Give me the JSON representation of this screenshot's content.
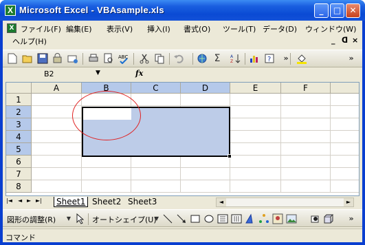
{
  "window": {
    "title": "Microsoft Excel - VBAsample.xls",
    "app_icon": "X",
    "minimize": "_",
    "maximize": "□",
    "close": "✕"
  },
  "menu": {
    "items": [
      "ファイル(F)",
      "編集(E)",
      "表示(V)",
      "挿入(I)",
      "書式(O)",
      "ツール(T)",
      "データ(D)",
      "ウィンドウ(W)"
    ],
    "help": "ヘルプ(H)",
    "mdi_minimize": "_",
    "mdi_restore": "ᗡ",
    "mdi_close": "×"
  },
  "toolbar": {
    "icons": [
      "new-icon",
      "open-icon",
      "save-icon",
      "permission-icon",
      "email-icon",
      "print-icon",
      "print-preview-icon",
      "spelling-icon",
      "cut-icon",
      "copy-icon",
      "undo-icon",
      "hyperlink-icon",
      "autosum-icon",
      "sort-ascending-icon",
      "chart-wizard-icon",
      "help-icon",
      "fill-color-icon"
    ],
    "autosum_glyph": "Σ",
    "overflow": "»"
  },
  "formula_bar": {
    "name_box": "B2",
    "fx": "fx",
    "formula": ""
  },
  "grid": {
    "columns": [
      "A",
      "B",
      "C",
      "D",
      "E",
      "F"
    ],
    "selected_columns": [
      "B",
      "C",
      "D"
    ],
    "rows": [
      "1",
      "2",
      "3",
      "4",
      "5",
      "6",
      "7",
      "8"
    ],
    "selected_rows": [
      "2",
      "3",
      "4",
      "5"
    ],
    "active_cell": "B2",
    "selection_range": "B2:D5"
  },
  "sheets": {
    "tabs": [
      "Sheet1",
      "Sheet2",
      "Sheet3"
    ],
    "active": "Sheet1",
    "nav": [
      "|◄",
      "◄",
      "►",
      "►|"
    ]
  },
  "drawing_toolbar": {
    "draw_menu": "図形の調整(R)",
    "autoshapes_menu": "オートシェイプ(U)"
  },
  "status": {
    "text": "コマンド"
  },
  "colors": {
    "title_bar": "#0a4ad4",
    "selection_fill": "#bdcce8",
    "header_selected": "#b5c9ea",
    "annotation_circle": "#e02020"
  }
}
